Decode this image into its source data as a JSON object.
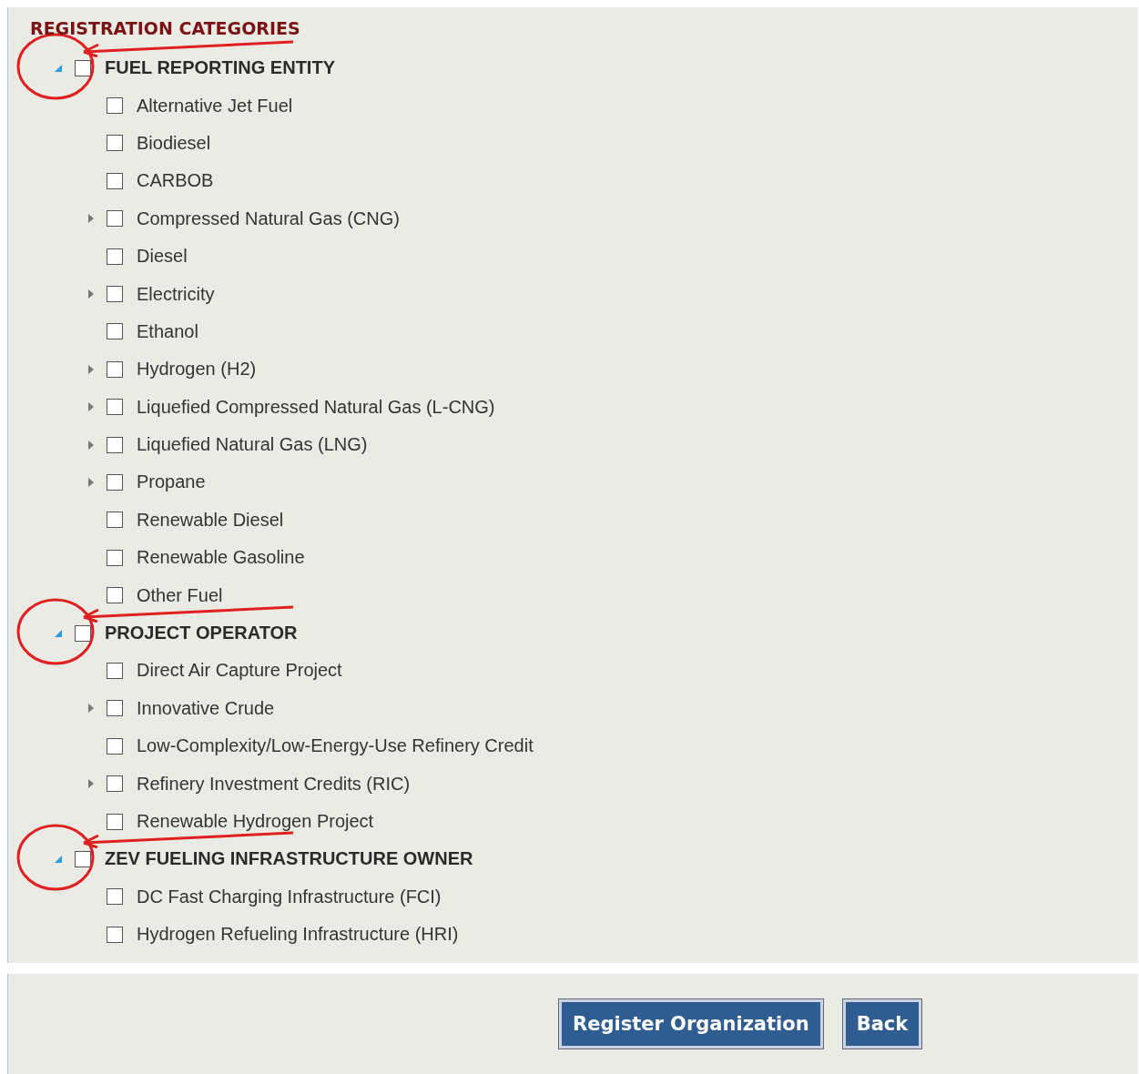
{
  "title": "REGISTRATION CATEGORIES",
  "groups": [
    {
      "label": "FUEL REPORTING ENTITY",
      "expanded": true,
      "checked": false,
      "highlighted": true,
      "children": [
        {
          "label": "Alternative Jet Fuel",
          "kind": "leaf",
          "checked": false
        },
        {
          "label": "Biodiesel",
          "kind": "leaf",
          "checked": false
        },
        {
          "label": "CARBOB",
          "kind": "leaf",
          "checked": false
        },
        {
          "label": "Compressed Natural Gas (CNG)",
          "kind": "branch",
          "checked": false
        },
        {
          "label": "Diesel",
          "kind": "leaf",
          "checked": false
        },
        {
          "label": "Electricity",
          "kind": "branch",
          "checked": false
        },
        {
          "label": "Ethanol",
          "kind": "leaf",
          "checked": false
        },
        {
          "label": "Hydrogen (H2)",
          "kind": "branch",
          "checked": false
        },
        {
          "label": "Liquefied Compressed Natural Gas (L-CNG)",
          "kind": "branch",
          "checked": false
        },
        {
          "label": "Liquefied Natural Gas (LNG)",
          "kind": "branch",
          "checked": false
        },
        {
          "label": "Propane",
          "kind": "branch",
          "checked": false
        },
        {
          "label": "Renewable Diesel",
          "kind": "leaf",
          "checked": false
        },
        {
          "label": "Renewable Gasoline",
          "kind": "leaf",
          "checked": false
        },
        {
          "label": "Other Fuel",
          "kind": "leaf",
          "checked": false
        }
      ]
    },
    {
      "label": "PROJECT OPERATOR",
      "expanded": true,
      "checked": false,
      "highlighted": true,
      "children": [
        {
          "label": "Direct Air Capture Project",
          "kind": "leaf",
          "checked": false
        },
        {
          "label": "Innovative Crude",
          "kind": "branch",
          "checked": false
        },
        {
          "label": "Low-Complexity/Low-Energy-Use Refinery Credit",
          "kind": "leaf",
          "checked": false
        },
        {
          "label": "Refinery Investment Credits (RIC)",
          "kind": "branch",
          "checked": false
        },
        {
          "label": "Renewable Hydrogen Project",
          "kind": "leaf",
          "checked": false
        }
      ]
    },
    {
      "label": "ZEV FUELING INFRASTRUCTURE OWNER",
      "expanded": true,
      "checked": false,
      "highlighted": true,
      "children": [
        {
          "label": "DC Fast Charging Infrastructure (FCI)",
          "kind": "leaf",
          "checked": false
        },
        {
          "label": "Hydrogen Refueling Infrastructure (HRI)",
          "kind": "leaf",
          "checked": false
        }
      ]
    }
  ],
  "buttons": [
    "Register Organization",
    "Back"
  ]
}
